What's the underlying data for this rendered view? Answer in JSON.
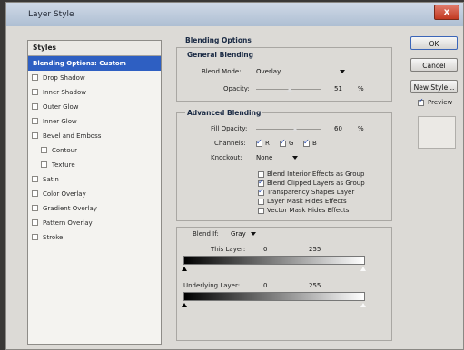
{
  "window": {
    "title": "Layer Style",
    "close_label": "x"
  },
  "styles": {
    "header": "Styles",
    "items": [
      {
        "label": "Blending Options: Custom",
        "selected": true,
        "checkbox": false,
        "sub": false
      },
      {
        "label": "Drop Shadow",
        "selected": false,
        "checkbox": true,
        "sub": false
      },
      {
        "label": "Inner Shadow",
        "selected": false,
        "checkbox": true,
        "sub": false
      },
      {
        "label": "Outer Glow",
        "selected": false,
        "checkbox": true,
        "sub": false
      },
      {
        "label": "Inner Glow",
        "selected": false,
        "checkbox": true,
        "sub": false
      },
      {
        "label": "Bevel and Emboss",
        "selected": false,
        "checkbox": true,
        "sub": false
      },
      {
        "label": "Contour",
        "selected": false,
        "checkbox": true,
        "sub": true
      },
      {
        "label": "Texture",
        "selected": false,
        "checkbox": true,
        "sub": true
      },
      {
        "label": "Satin",
        "selected": false,
        "checkbox": true,
        "sub": false
      },
      {
        "label": "Color Overlay",
        "selected": false,
        "checkbox": true,
        "sub": false
      },
      {
        "label": "Gradient Overlay",
        "selected": false,
        "checkbox": true,
        "sub": false
      },
      {
        "label": "Pattern Overlay",
        "selected": false,
        "checkbox": true,
        "sub": false
      },
      {
        "label": "Stroke",
        "selected": false,
        "checkbox": true,
        "sub": false
      }
    ]
  },
  "blending": {
    "section_title": "Blending Options",
    "general": {
      "title": "General Blending",
      "blend_mode_label": "Blend Mode:",
      "blend_mode_value": "Overlay",
      "opacity_label": "Opacity:",
      "opacity_value": "51",
      "opacity_unit": "%"
    },
    "advanced": {
      "title": "Advanced Blending",
      "fill_opacity_label": "Fill Opacity:",
      "fill_opacity_value": "60",
      "fill_opacity_unit": "%",
      "channels_label": "Channels:",
      "channel_r": "R",
      "channel_g": "G",
      "channel_b": "B",
      "knockout_label": "Knockout:",
      "knockout_value": "None",
      "options": [
        {
          "label": "Blend Interior Effects as Group",
          "checked": false
        },
        {
          "label": "Blend Clipped Layers as Group",
          "checked": true
        },
        {
          "label": "Transparency Shapes Layer",
          "checked": true
        },
        {
          "label": "Layer Mask Hides Effects",
          "checked": false
        },
        {
          "label": "Vector Mask Hides Effects",
          "checked": false
        }
      ]
    },
    "blend_if": {
      "label": "Blend If:",
      "value": "Gray",
      "this_layer_label": "This Layer:",
      "this_layer_min": "0",
      "this_layer_max": "255",
      "underlying_label": "Underlying Layer:",
      "underlying_min": "0",
      "underlying_max": "255"
    }
  },
  "buttons": {
    "ok": "OK",
    "cancel": "Cancel",
    "new_style": "New Style...",
    "preview": "Preview",
    "preview_checked": true
  },
  "colors": {
    "selection": "#2e5fc2",
    "dialog_bg": "#dcdad6"
  }
}
